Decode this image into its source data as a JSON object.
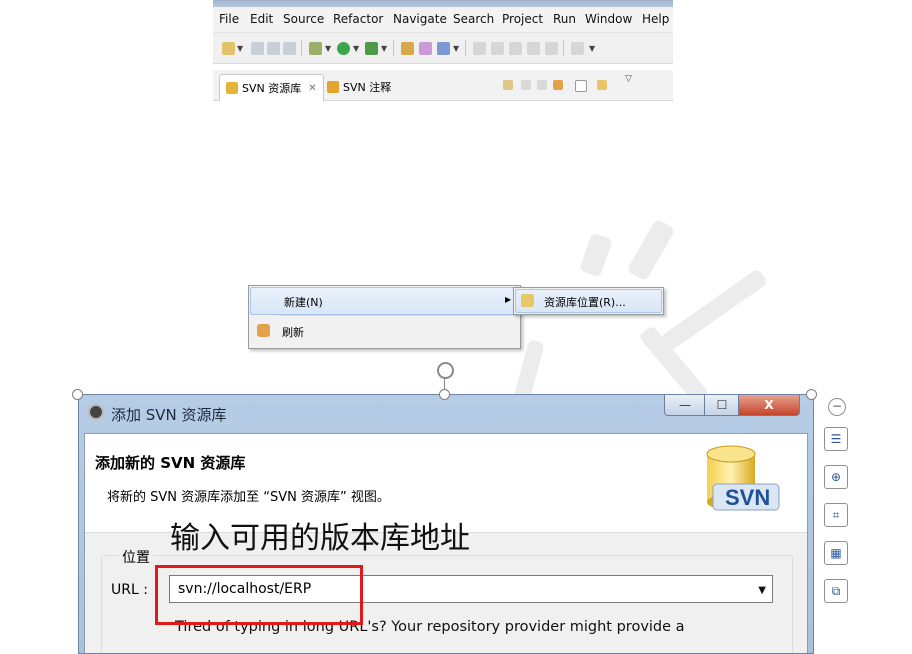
{
  "eclipse": {
    "menu": [
      "File",
      "Edit",
      "Source",
      "Refactor",
      "Navigate",
      "Search",
      "Project",
      "Run",
      "Window",
      "Help"
    ],
    "tabs": [
      {
        "label": "SVN 资源库",
        "icon": "svn-repo-icon",
        "close": "✕"
      },
      {
        "label": "SVN 注释",
        "icon": "svn-annotate-icon"
      }
    ],
    "context_menu": {
      "items": [
        {
          "label": "新建(N)",
          "icon": "",
          "has_submenu": true
        },
        {
          "label": "刷新",
          "icon": "refresh-icon"
        }
      ],
      "submenu": {
        "label": "资源库位置(R)...",
        "icon": "repository-location-icon"
      }
    }
  },
  "dialog": {
    "title": "添加 SVN 资源库",
    "heading": "添加新的 SVN 资源库",
    "description": "将新的 SVN 资源库添加至 “SVN 资源库” 视图。",
    "logo_text": "SVN",
    "location_group": "位置",
    "url_label": "URL :",
    "url_value": "svn://localhost/ERP",
    "hint": "Tired of typing in long URL's?  Your repository provider might provide a",
    "window_buttons": {
      "minimize": "—",
      "maximize": "☐",
      "close": "X"
    }
  },
  "annotation": {
    "text": "输入可用的版本库地址",
    "box_color": "#e0191b"
  },
  "side_tools": [
    "minus-icon",
    "layout-options-icon",
    "zoom-in-icon",
    "crop-icon",
    "selection-icon",
    "copy-format-icon"
  ],
  "colors": {
    "accent": "#a9c1dd",
    "highlight": "#d7e6f7",
    "annotation_red": "#e0191b"
  }
}
